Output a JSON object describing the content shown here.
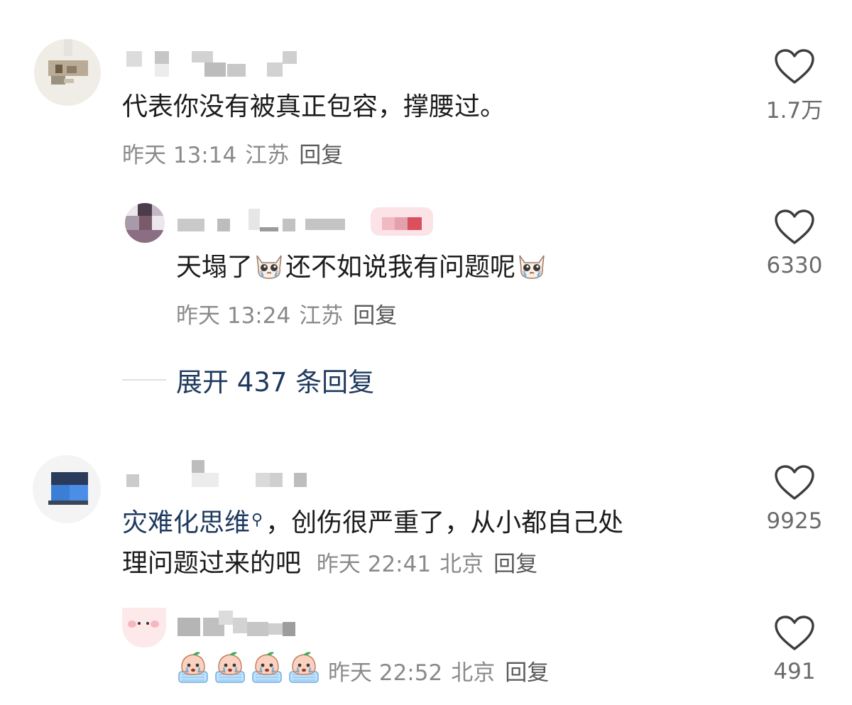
{
  "comments": [
    {
      "text": "代表你没有被真正包容，撑腰过。",
      "time": "昨天 13:14",
      "location": "江苏",
      "reply_label": "回复",
      "likes": "1.7万"
    },
    {
      "text_a": "天塌了",
      "text_b": "还不如说我有问题呢",
      "time": "昨天 13:24",
      "location": "江苏",
      "reply_label": "回复",
      "likes": "6330"
    },
    {
      "keyword": "灾难化思维",
      "text_line1": "，创伤很严重了，从小都自己处",
      "text_line2": "理问题过来的吧",
      "time": "昨天 22:41",
      "location": "北京",
      "reply_label": "回复",
      "likes": "9925"
    },
    {
      "time": "昨天 22:52",
      "location": "北京",
      "reply_label": "回复",
      "likes": "491"
    }
  ],
  "expand_replies": "展开 437 条回复",
  "icons": {
    "like": "heart-outline-icon",
    "search": "search-icon",
    "emoji_cat": "crying-cat-emoji",
    "emoji_peach": "peach-cry-emoji"
  },
  "colors": {
    "link": "#1f3a5f",
    "meta": "#8a8a8a",
    "text": "#1c1c1c"
  }
}
